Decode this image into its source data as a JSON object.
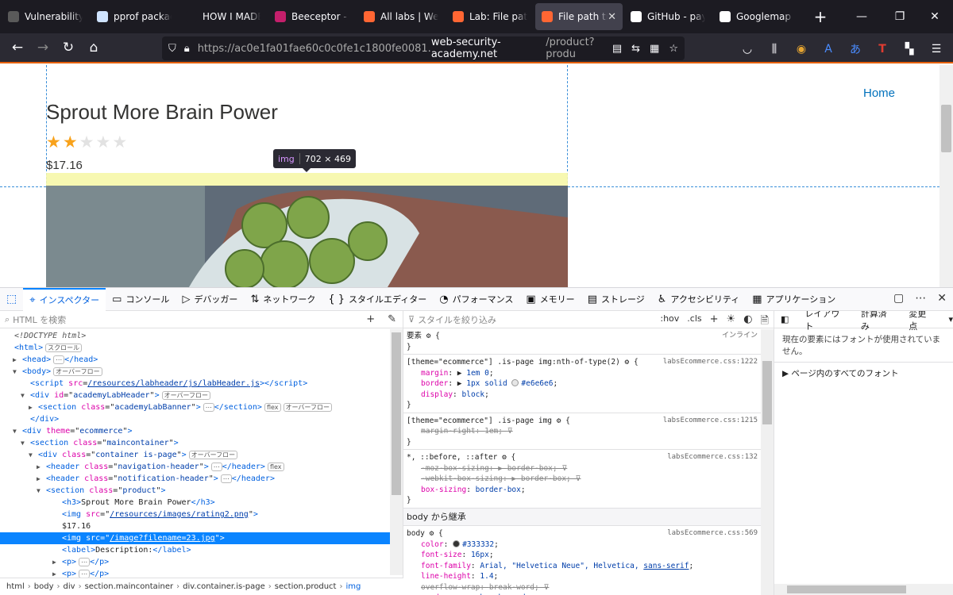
{
  "tabs": [
    {
      "label": "Vulnerability: S",
      "icon_color": "#5a5a5a",
      "icon": "globe-icon"
    },
    {
      "label": "pprof package",
      "icon_color": "#cfe3ff",
      "icon": "doc-icon"
    },
    {
      "label": "HOW I MADE",
      "icon_color": "#1c1b22",
      "icon": "blank-icon"
    },
    {
      "label": "Beeceptor - Z",
      "icon_color": "#c41f6b",
      "icon": "beeceptor-icon"
    },
    {
      "label": "All labs | Web",
      "icon_color": "#ff6633",
      "icon": "portswigger-icon"
    },
    {
      "label": "Lab: File path",
      "icon_color": "#ff6633",
      "icon": "portswigger-icon"
    },
    {
      "label": "File path tra",
      "icon_color": "#ff6633",
      "icon": "portswigger-icon",
      "active": true
    },
    {
      "label": "GitHub - paylo",
      "icon_color": "#ffffff",
      "icon": "github-icon"
    },
    {
      "label": "Googlemap co",
      "icon_color": "#ffffff",
      "icon": "google-icon"
    }
  ],
  "url": {
    "prefix": "https://ac0e1fa01fae60c0c0fe1c1800fe0081.",
    "domain": "web-security-academy.net",
    "path": "/product?produ"
  },
  "page": {
    "title": "Sprout More Brain Power",
    "rating_filled": 2,
    "rating_max": 5,
    "price": "$17.16",
    "home_link": "Home",
    "tooltip_tag": "img",
    "tooltip_size": "702 × 469"
  },
  "devtools": {
    "tabs": [
      "インスペクター",
      "コンソール",
      "デバッガー",
      "ネットワーク",
      "スタイルエディター",
      "パフォーマンス",
      "メモリー",
      "ストレージ",
      "アクセシビリティ",
      "アプリケーション"
    ],
    "html_search_placeholder": "HTML を検索",
    "style_filter_placeholder": "スタイルを絞り込み",
    "hov": ":hov",
    "cls": ".cls",
    "right_tabs": [
      "レイアウト",
      "計算済み",
      "変更点"
    ],
    "font_msg": "現在の要素にはフォントが使用されていません。",
    "all_fonts": "ページ内のすべてのフォント",
    "inherit_label": "body から継承",
    "element_label": "要素",
    "inline_label": "インライン",
    "breadcrumbs": [
      "html",
      "body",
      "div",
      "section.maincontainer",
      "div.container.is-page",
      "section.product",
      "img"
    ]
  },
  "tree": {
    "doctype": "<!DOCTYPE html>",
    "badge_scroll": "スクロール",
    "badge_overflow": "オーバーフロー",
    "badge_flex": "flex",
    "badge_ellipsis": "⋯",
    "script_src": "/resources/labheader/js/labHeader.js",
    "div_id": "academyLabHeader",
    "section_class_banner": "academyLabBanner",
    "div_theme": "ecommerce",
    "section_maincontainer": "maincontainer",
    "div_container": "container is-page",
    "header_nav": "navigation-header",
    "header_notif": "notification-header",
    "section_product": "product",
    "h3_text": "Sprout More Brain Power",
    "img_rating_src": "/resources/images/rating2.png",
    "price_text": "$17.16",
    "img_selected_src": "/image?filename=23.jpg",
    "label_text": "Description:"
  }
}
